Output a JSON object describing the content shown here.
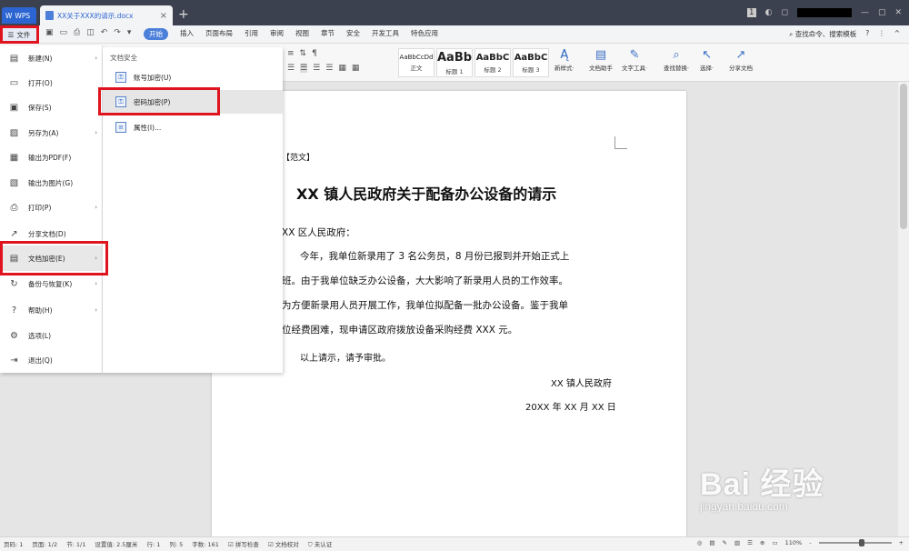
{
  "titlebar": {
    "app_tab": "WPS",
    "doc_tab": "XX关于XXX的请示.docx",
    "close": "×",
    "new_tab": "+"
  },
  "tabs_row": {
    "file_label": "文件",
    "tabs": [
      "开始",
      "插入",
      "页面布局",
      "引用",
      "审阅",
      "视图",
      "章节",
      "安全",
      "开发工具",
      "特色应用"
    ],
    "search_label": "查找命令、搜索模板",
    "help": "?"
  },
  "ribbon": {
    "styles": [
      {
        "preview": "AaBbCcDd",
        "name": "正文"
      },
      {
        "preview": "AaBb",
        "name": "标题 1"
      },
      {
        "preview": "AaBbC",
        "name": "标题 2"
      },
      {
        "preview": "AaBbC",
        "name": "标题 3"
      }
    ],
    "new_style": "新样式·",
    "doc_helper": "文档助手",
    "text_tools": "文字工具·",
    "find_replace": "查找替换·",
    "select": "选择·",
    "share_doc": "分享文档"
  },
  "file_menu": {
    "items": [
      {
        "label": "新建(N)",
        "icon": "new-doc-icon",
        "glyph": "▤",
        "arrow": "›"
      },
      {
        "label": "打开(O)",
        "icon": "folder-icon",
        "glyph": "▭",
        "arrow": ""
      },
      {
        "label": "保存(S)",
        "icon": "save-icon",
        "glyph": "▣",
        "arrow": ""
      },
      {
        "label": "另存为(A)",
        "icon": "save-as-icon",
        "glyph": "▨",
        "arrow": "›"
      },
      {
        "label": "输出为PDF(F)",
        "icon": "pdf-icon",
        "glyph": "▦",
        "arrow": ""
      },
      {
        "label": "输出为图片(G)",
        "icon": "image-icon",
        "glyph": "▧",
        "arrow": ""
      },
      {
        "label": "打印(P)",
        "icon": "print-icon",
        "glyph": "⎙",
        "arrow": "›"
      },
      {
        "label": "分享文档(D)",
        "icon": "share-icon",
        "glyph": "↗",
        "arrow": ""
      },
      {
        "label": "文档加密(E)",
        "icon": "encrypt-doc-icon",
        "glyph": "▤",
        "arrow": "›"
      },
      {
        "label": "备份与恢复(K)",
        "icon": "backup-icon",
        "glyph": "↻",
        "arrow": "›"
      },
      {
        "label": "帮助(H)",
        "icon": "help-icon",
        "glyph": "?",
        "arrow": "›"
      },
      {
        "label": "选项(L)",
        "icon": "gear-icon",
        "glyph": "⚙",
        "arrow": ""
      },
      {
        "label": "退出(Q)",
        "icon": "exit-icon",
        "glyph": "⇥",
        "arrow": ""
      }
    ]
  },
  "submenu": {
    "heading": "文档安全",
    "items": [
      {
        "label": "账号加密(U)",
        "icon": "account-lock-icon"
      },
      {
        "label": "密码加密(P)",
        "icon": "password-lock-icon"
      },
      {
        "label": "属性(I)...",
        "icon": "properties-icon"
      }
    ]
  },
  "document": {
    "tag": "【范文】",
    "title": "XX 镇人民政府关于配备办公设备的请示",
    "salutation": "XX 区人民政府：",
    "lines": [
      "今年，我单位新录用了 3 名公务员，8 月份已报到并开始正式上",
      "班。由于我单位缺乏办公设备，大大影响了新录用人员的工作效率。",
      "为方便新录用人员开展工作，我单位拟配备一批办公设备。鉴于我单",
      "位经费困难，现申请区政府拨放设备采购经费 XXX 元。"
    ],
    "closing": "以上请示，请予审批。",
    "signature": "XX 镇人民政府",
    "date": "20XX 年 XX 月 XX 日"
  },
  "statusbar": {
    "items": [
      "页码: 1",
      "页面: 1/2",
      "节: 1/1",
      "设置值: 2.5厘米",
      "行: 1",
      "列: 5",
      "字数: 161",
      "拼写检查",
      "文档校对",
      "未认证"
    ],
    "zoom": "110%",
    "zoom_minus": "-",
    "zoom_plus": "+",
    "zoom_fraction": 0.55
  },
  "watermark": {
    "brand": "Bai 经验",
    "url": "jingyan.baidu.com"
  }
}
